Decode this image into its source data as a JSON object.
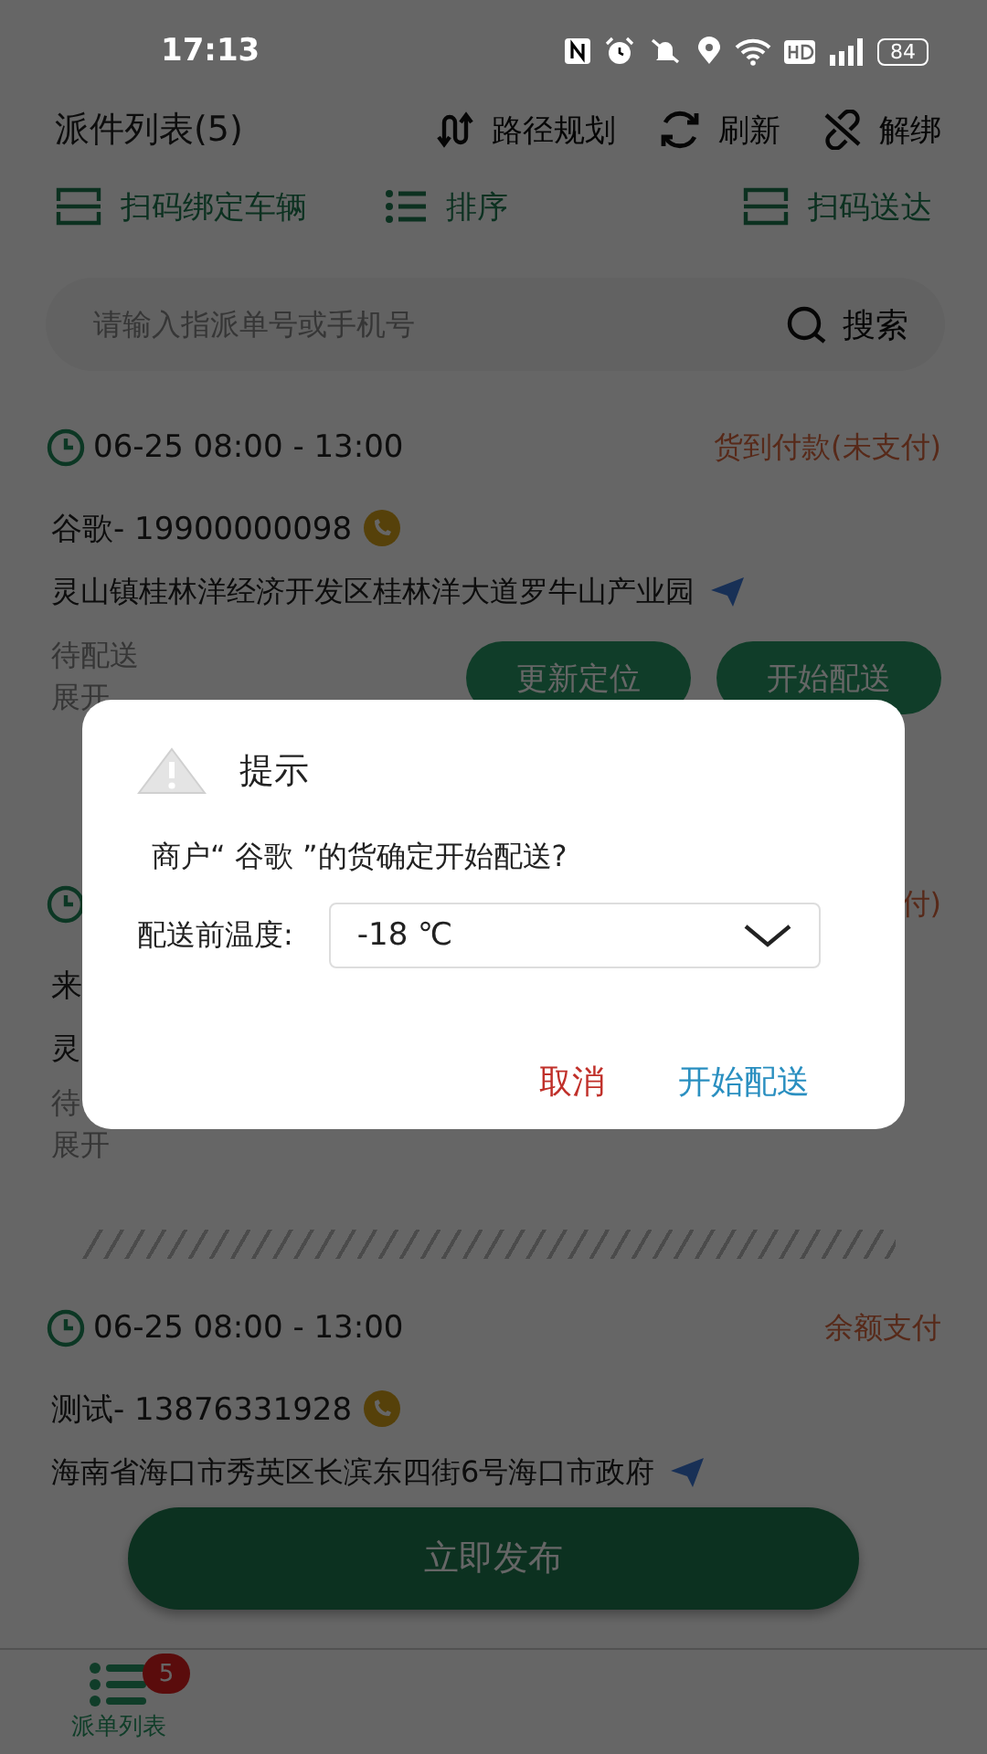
{
  "status_bar": {
    "time": "17:13",
    "battery": "84"
  },
  "header": {
    "title": "派件列表(5)",
    "actions": [
      {
        "label": "路径规划",
        "kind": "route"
      },
      {
        "label": "刷新",
        "kind": "refresh"
      },
      {
        "label": "解绑",
        "kind": "unlink"
      }
    ]
  },
  "toolbar": [
    {
      "label": "扫码绑定车辆",
      "kind": "scan"
    },
    {
      "label": "排序",
      "kind": "sort"
    },
    {
      "label": "扫码送达",
      "kind": "scan"
    }
  ],
  "search": {
    "placeholder": "请输入指派单号或手机号",
    "button": "搜索"
  },
  "orders": [
    {
      "time": "06-25  08:00 - 13:00",
      "payment": "货到付款(未支付)",
      "contact": "谷歌- 19900000098",
      "address": "灵山镇桂林洋经济开发区桂林洋大道罗牛山产业园",
      "status": "待配送",
      "expand": "展开",
      "buttons": [
        "更新定位",
        "开始配送"
      ]
    },
    {
      "payment": "付)",
      "contact": "来",
      "address": "灵",
      "status": "待",
      "expand": "展开"
    },
    {
      "time": "06-25  08:00 - 13:00",
      "payment": "余额支付",
      "contact": "测试- 13876331928",
      "address": "海南省海口市秀英区长滨东四街6号海口市政府"
    }
  ],
  "publish_button": "立即发布",
  "bottom_nav": [
    {
      "label": "派单列表",
      "badge": "5",
      "selected": true
    }
  ],
  "dialog": {
    "title": "提示",
    "message": "商户“ 谷歌 ”的货确定开始配送?",
    "field_label": "配送前温度:",
    "temperature": "-18 ℃",
    "cancel": "取消",
    "confirm": "开始配送"
  }
}
